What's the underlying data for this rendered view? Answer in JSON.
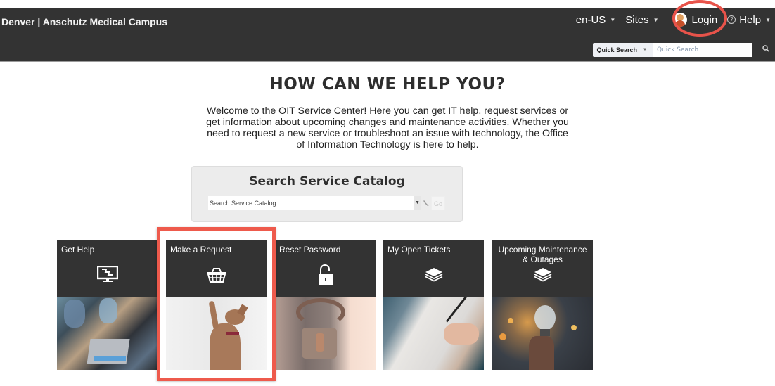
{
  "header": {
    "brand": "Denver | Anschutz Medical Campus",
    "nav": {
      "language": "en-US",
      "sites": "Sites",
      "login": "Login",
      "help": "Help",
      "help_icon_glyph": "?"
    },
    "quick_search": {
      "scope_label": "Quick Search",
      "placeholder": "Quick Search"
    }
  },
  "main": {
    "title": "HOW CAN WE HELP YOU?",
    "intro": "Welcome to the OIT Service Center! Here you can get IT help, request services or get information about upcoming changes and maintenance activities. Whether you need to request a new service or troubleshoot an issue with technology, the Office of Information Technology is here to help.",
    "catalog": {
      "title": "Search Service Catalog",
      "placeholder": "Search Service Catalog",
      "dropdown_glyph": "▼",
      "go_label": "Go"
    },
    "tiles": [
      {
        "label": "Get Help",
        "icon": "broken-monitor-icon",
        "image": "people-with-laptop"
      },
      {
        "label": "Make a Request",
        "icon": "basket-icon",
        "image": "dog-raising-paw"
      },
      {
        "label": "Reset Password",
        "icon": "unlocked-padlock-icon",
        "image": "padlock-on-chain"
      },
      {
        "label": "My Open Tickets",
        "icon": "layers-icon",
        "image": "checklist-writing"
      },
      {
        "label": "Upcoming Maintenance & Outages",
        "icon": "layers-icon",
        "image": "lightbulb-in-hand"
      }
    ]
  },
  "annotations": {
    "highlight_color": "#ee5a4c",
    "highlighted_tile": "Make a Request",
    "circled_item": "Login"
  },
  "colors": {
    "header_bg": "#333333",
    "tile_bg": "#333333",
    "catalog_bg": "#ececec"
  }
}
